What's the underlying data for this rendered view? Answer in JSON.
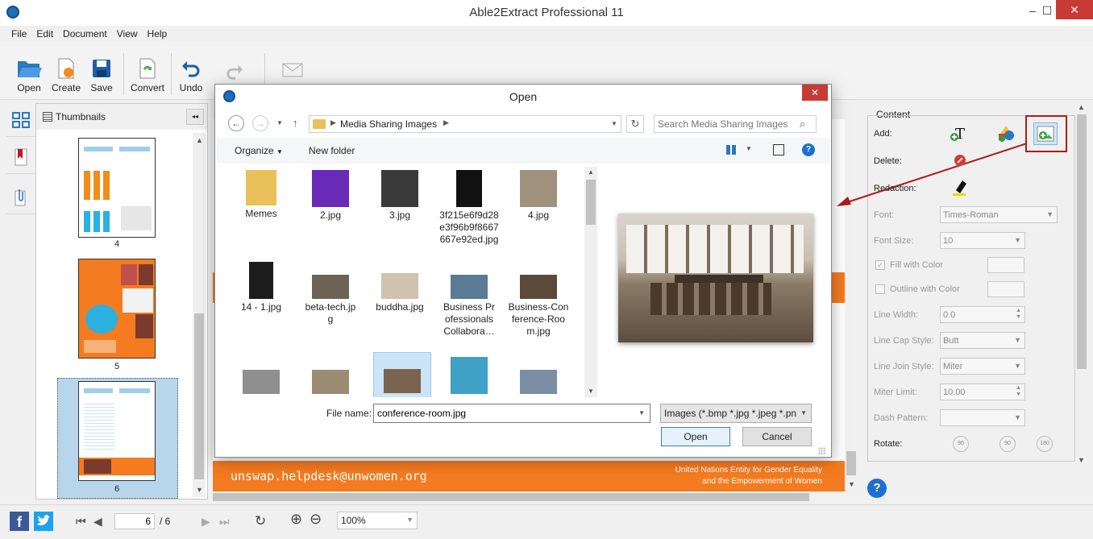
{
  "app": {
    "title": "Able2Extract Professional 11",
    "window_controls": {
      "minimize": "–",
      "maximize": "☐",
      "close": "✕"
    }
  },
  "menu": [
    "File",
    "Edit",
    "Document",
    "View",
    "Help"
  ],
  "toolbar": {
    "open": "Open",
    "create": "Create",
    "save": "Save",
    "convert": "Convert",
    "undo": "Undo"
  },
  "thumbnails": {
    "title": "Thumbnails",
    "collapse": "◂◂",
    "pages": [
      "4",
      "5",
      "6"
    ]
  },
  "document": {
    "footer_email": "unswap.helpdesk@unwomen.org",
    "footer_org_line1": "United Nations Entity for Gender Equality",
    "footer_org_line2": "and the Empowerment of Women"
  },
  "content_panel": {
    "title": "Content",
    "add": "Add:",
    "delete": "Delete:",
    "redaction": "Redaction:",
    "font": "Font:",
    "font_value": "Times-Roman",
    "font_size": "Font Size:",
    "font_size_value": "10",
    "fill_with_color": "Fill with Color",
    "outline_with_color": "Outline with Color",
    "line_width": "Line Width:",
    "line_width_value": "0.0",
    "line_cap_style": "Line Cap Style:",
    "line_cap_value": "Butt",
    "line_join_style": "Line Join Style:",
    "line_join_value": "Miter",
    "miter_limit": "Miter Limit:",
    "miter_limit_value": "10.00",
    "dash_pattern": "Dash Pattern:",
    "rotate": "Rotate:",
    "rotate_values": [
      "90",
      "90",
      "180"
    ],
    "help": "?"
  },
  "dialog": {
    "title": "Open",
    "close": "✕",
    "path": "Media Sharing Images",
    "search_placeholder": "Search Media Sharing Images",
    "organize": "Organize",
    "new_folder": "New folder",
    "files": [
      {
        "name": "Memes",
        "color": "#e8c15a"
      },
      {
        "name": "2.jpg",
        "color": "#6a2ab8"
      },
      {
        "name": "3.jpg",
        "color": "#3a3a3a"
      },
      {
        "name": "3f215e6f9d28e3f96b9f8667667e92ed.jpg",
        "color": "#111111"
      },
      {
        "name": "4.jpg",
        "color": "#a0927c"
      },
      {
        "name": "14 - 1.jpg",
        "color": "#1d1d1d"
      },
      {
        "name": "beta-tech.jpg",
        "color": "#6d6355"
      },
      {
        "name": "buddha.jpg",
        "color": "#cfc2ae"
      },
      {
        "name": "Business Professionals Collabora…",
        "color": "#5a7a96"
      },
      {
        "name": "Business-Conference-Room.jpg",
        "color": "#5b4a3a"
      },
      {
        "name": "",
        "color": "#8f8f8f"
      },
      {
        "name": "",
        "color": "#9a8b73"
      },
      {
        "name": "",
        "color": "#7a6450"
      },
      {
        "name": "",
        "color": "#3fa1c6"
      },
      {
        "name": "",
        "color": "#7c8ea4"
      }
    ],
    "file_name_label": "File name:",
    "file_name_value": "conference-room.jpg",
    "file_type_value": "Images (*.bmp *.jpg *.jpeg *.pn",
    "open_button": "Open",
    "cancel_button": "Cancel"
  },
  "status": {
    "current_page": "6",
    "separator": "/ 6",
    "zoom": "100%"
  },
  "colors": {
    "accent_orange": "#f47b20",
    "highlight_red": "#b01a1a",
    "selection_blue": "#cce4f7",
    "twitter": "#1da1f2",
    "facebook": "#3b5998"
  }
}
